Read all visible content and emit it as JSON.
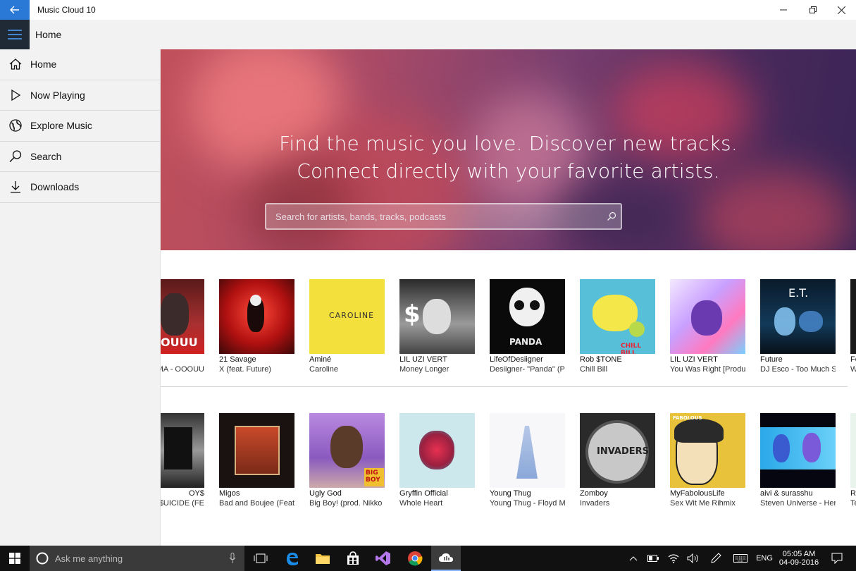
{
  "app": {
    "title": "Music Cloud 10"
  },
  "header": {
    "title": "Home"
  },
  "sidebar": {
    "items": [
      {
        "label": "Home",
        "icon": "home-icon"
      },
      {
        "label": "Now Playing",
        "icon": "play-icon"
      },
      {
        "label": "Explore Music",
        "icon": "globe-icon"
      },
      {
        "label": "Search",
        "icon": "search-icon"
      },
      {
        "label": "Downloads",
        "icon": "download-icon"
      }
    ]
  },
  "hero": {
    "line1": "Find the music you love. Discover new tracks.",
    "line2": "Connect directly with your favorite artists.",
    "search_placeholder": "Search for artists, bands, tracks, podcasts"
  },
  "tracks_row1": [
    {
      "artist": "",
      "title": "MA - OOOUU",
      "cover_text": "OUUU"
    },
    {
      "artist": "21 Savage",
      "title": "X (feat. Future)",
      "cover_text": ""
    },
    {
      "artist": "Aminé",
      "title": "Caroline",
      "cover_text": "CAROLINE"
    },
    {
      "artist": "LIL UZI VERT",
      "title": "Money Longer",
      "cover_text": "$"
    },
    {
      "artist": "LifeOfDesiigner",
      "title": "Desiigner- \"Panda\" (Pro",
      "cover_text": "PANDA"
    },
    {
      "artist": "Rob $TONE",
      "title": "Chill Bill",
      "cover_text": "CHILL BILL"
    },
    {
      "artist": "LIL UZI VERT",
      "title": "You Was Right [Produc",
      "cover_text": ""
    },
    {
      "artist": "Future",
      "title": "DJ Esco - Too Much Sa",
      "cover_text": "E.T."
    },
    {
      "artist": "Fe",
      "title": "W",
      "cover_text": ""
    }
  ],
  "tracks_row2": [
    {
      "artist": "OY$",
      "title": "E $UICIDE (FE",
      "cover_text": ""
    },
    {
      "artist": "Migos",
      "title": "Bad and Boujee (Feat. L",
      "cover_text": ""
    },
    {
      "artist": "Ugly God",
      "title": "Big Boy! (prod. Nikko B",
      "cover_text": "BIG BOY"
    },
    {
      "artist": "Gryffin Official",
      "title": "Whole Heart",
      "cover_text": ""
    },
    {
      "artist": "Young Thug",
      "title": "Young Thug - Floyd Ma",
      "cover_text": ""
    },
    {
      "artist": "Zomboy",
      "title": "Invaders",
      "cover_text": "INVADERS"
    },
    {
      "artist": "MyFabolousLife",
      "title": "Sex Wit Me Rihmix",
      "cover_text": "FABOLOUS"
    },
    {
      "artist": "aivi & surasshu",
      "title": "Steven Universe - Here",
      "cover_text": ""
    },
    {
      "artist": "Re",
      "title": "Te",
      "cover_text": ""
    }
  ],
  "taskbar": {
    "cortana_placeholder": "Ask me anything",
    "language": "ENG",
    "time": "05:05 AM",
    "date": "04-09-2016"
  },
  "colors": {
    "accent": "#2b79d6",
    "sidebar_bg": "#f2f2f2",
    "hamburger_bg": "#1f2a36",
    "taskbar": "#111111"
  }
}
